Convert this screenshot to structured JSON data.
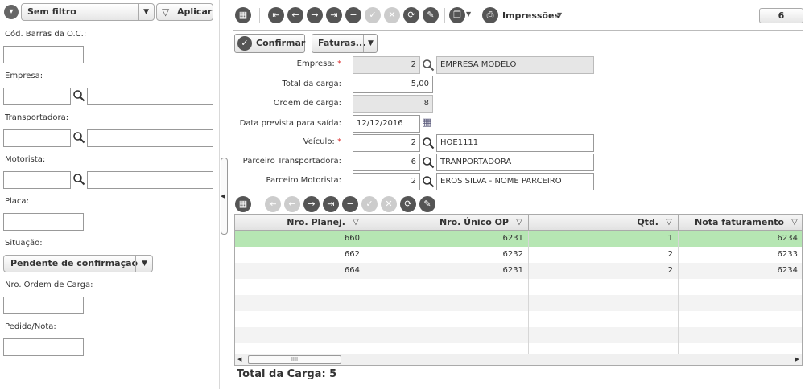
{
  "filter_bar": {
    "filter_select": "Sem filtro",
    "apply_label": "Aplicar"
  },
  "left_fields": {
    "cod_barras_label": "Cód. Barras da O.C.:",
    "empresa_label": "Empresa:",
    "transportadora_label": "Transportadora:",
    "motorista_label": "Motorista:",
    "placa_label": "Placa:",
    "situacao_label": "Situação:",
    "situacao_value": "Pendente de confirmação",
    "nro_ordem_label": "Nro. Ordem de Carga:",
    "pedido_label": "Pedido/Nota:"
  },
  "toolbar": {
    "impressoes_label": "Impressões",
    "record_count": "6"
  },
  "actions": {
    "confirm_label": "Confirmar",
    "faturas_label": "Faturas..."
  },
  "form": {
    "empresa_label": "Empresa:",
    "empresa_code": "2",
    "empresa_name": "EMPRESA MODELO",
    "total_carga_label": "Total da carga:",
    "total_carga_value": "5,00",
    "ordem_carga_label": "Ordem de carga:",
    "ordem_carga_value": "8",
    "data_prevista_label": "Data prevista para saída:",
    "data_prevista_value": "12/12/2016",
    "veiculo_label": "Veículo:",
    "veiculo_code": "2",
    "veiculo_name": "HOE1111",
    "parc_transp_label": "Parceiro Transportadora:",
    "parc_transp_code": "6",
    "parc_transp_name": "TRANPORTADORA",
    "parc_mot_label": "Parceiro Motorista:",
    "parc_mot_code": "2",
    "parc_mot_name": "EROS SILVA - NOME PARCEIRO"
  },
  "grid": {
    "columns": [
      "Nro. Planej.",
      "Nro. Único OP",
      "Qtd.",
      "Nota faturamento"
    ],
    "rows": [
      [
        "660",
        "6231",
        "1",
        "6234"
      ],
      [
        "662",
        "6232",
        "2",
        "6233"
      ],
      [
        "664",
        "6231",
        "2",
        "6234"
      ]
    ],
    "selected_row_color": "#b6e6b3"
  },
  "footer": {
    "total_label": "Total da Carga: 5"
  }
}
